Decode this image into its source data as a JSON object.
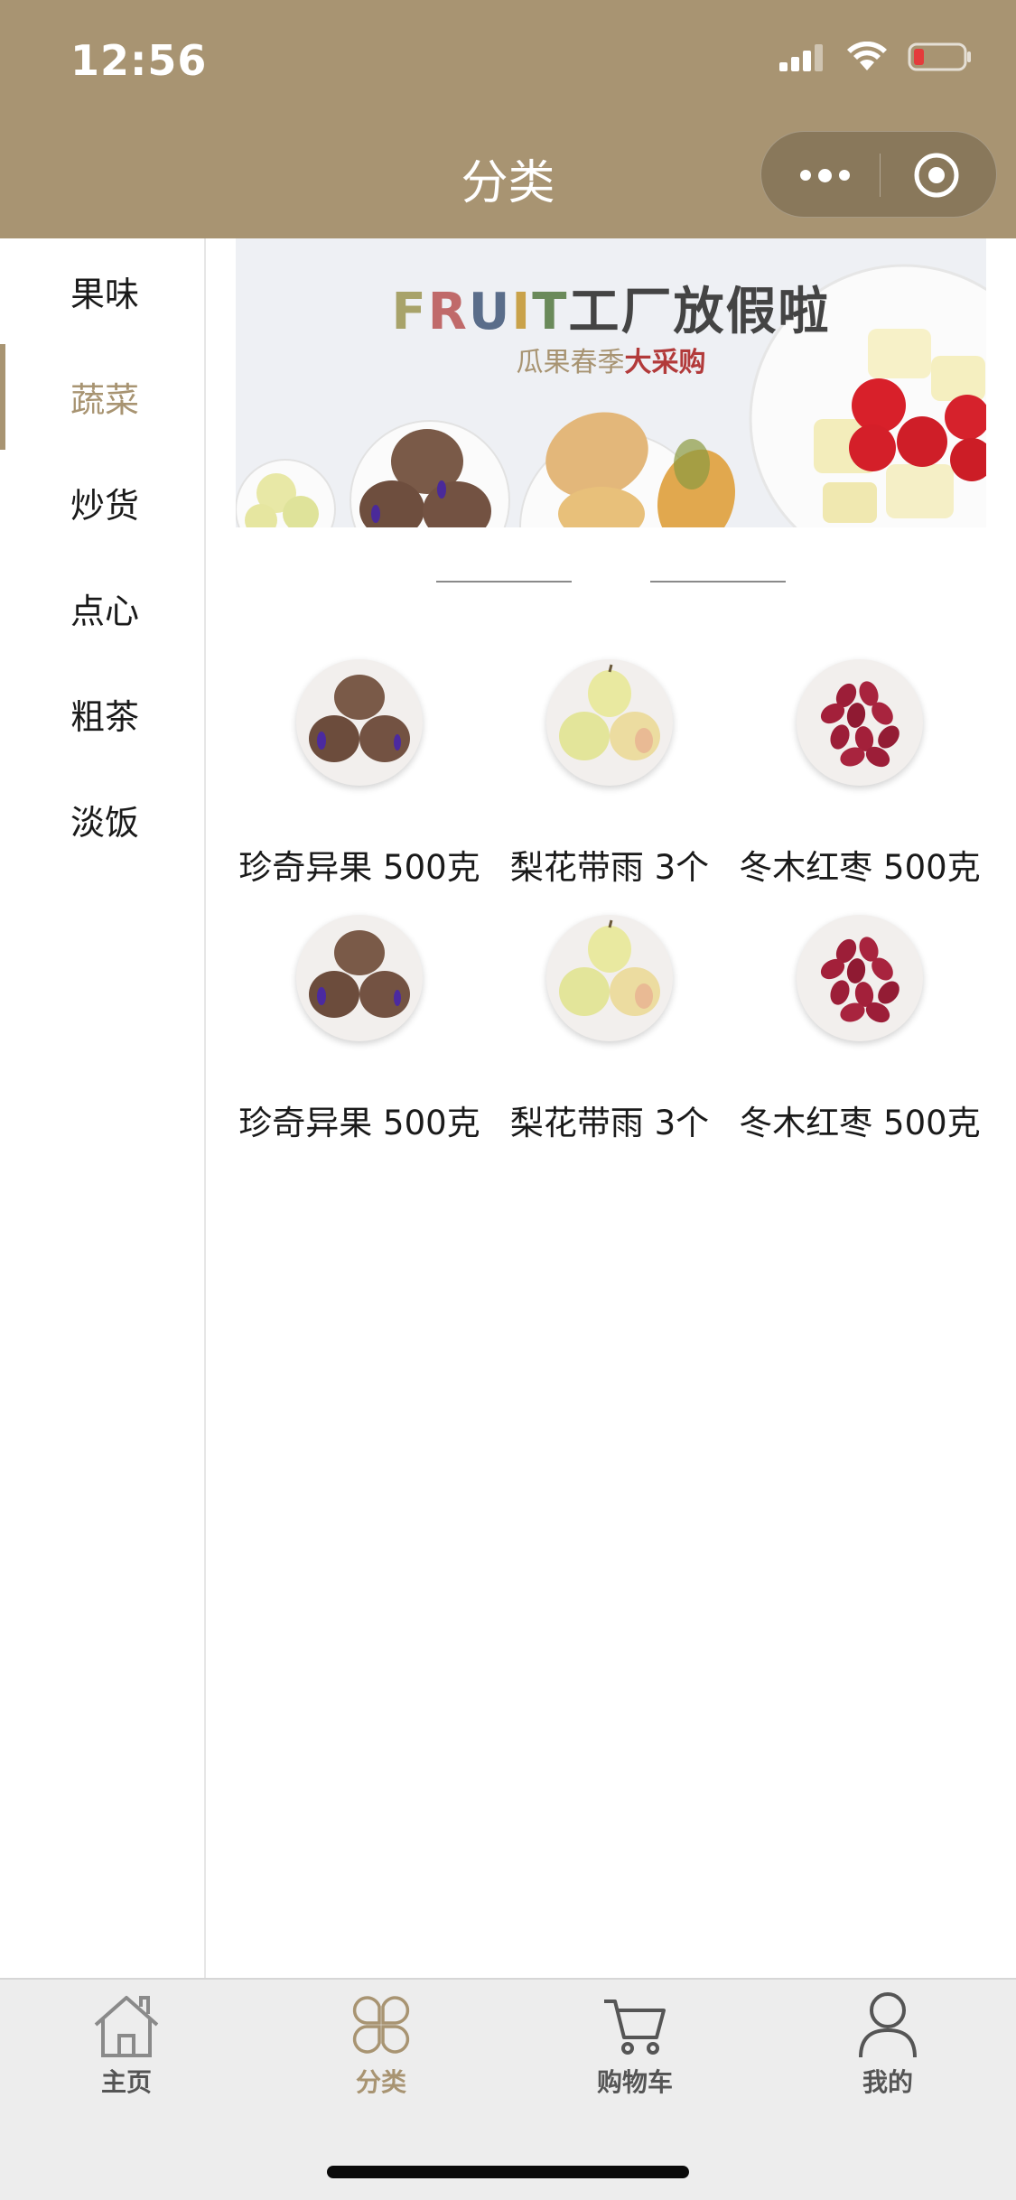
{
  "status_bar": {
    "time": "12:56"
  },
  "nav": {
    "title": "分类"
  },
  "sidebar": {
    "items": [
      {
        "label": "果味",
        "active": false
      },
      {
        "label": "蔬菜",
        "active": true
      },
      {
        "label": "炒货",
        "active": false
      },
      {
        "label": "点心",
        "active": false
      },
      {
        "label": "粗茶",
        "active": false
      },
      {
        "label": "淡饭",
        "active": false
      }
    ]
  },
  "banner": {
    "title_letters": [
      "F",
      "R",
      "U",
      "I",
      "T"
    ],
    "title_rest": "工厂放假啦",
    "subtitle_plain": "瓜果春季",
    "subtitle_highlight": "大采购"
  },
  "products": [
    {
      "name": "珍奇异果 500克",
      "image": "kiwi-image"
    },
    {
      "name": "梨花带雨 3个",
      "image": "pear-image"
    },
    {
      "name": "冬木红枣 500克",
      "image": "jujube-image"
    },
    {
      "name": "珍奇异果 500克",
      "image": "kiwi-image"
    },
    {
      "name": "梨花带雨 3个",
      "image": "pear-image"
    },
    {
      "name": "冬木红枣 500克",
      "image": "jujube-image"
    }
  ],
  "tabbar": {
    "items": [
      {
        "label": "主页",
        "icon": "home-icon",
        "active": false
      },
      {
        "label": "分类",
        "icon": "category-icon",
        "active": true
      },
      {
        "label": "购物车",
        "icon": "cart-icon",
        "active": false
      },
      {
        "label": "我的",
        "icon": "profile-icon",
        "active": false
      }
    ]
  },
  "colors": {
    "brand": "#a89472",
    "sidebar_divider": "#e6e6e6",
    "tabbar_bg": "#ededed"
  }
}
